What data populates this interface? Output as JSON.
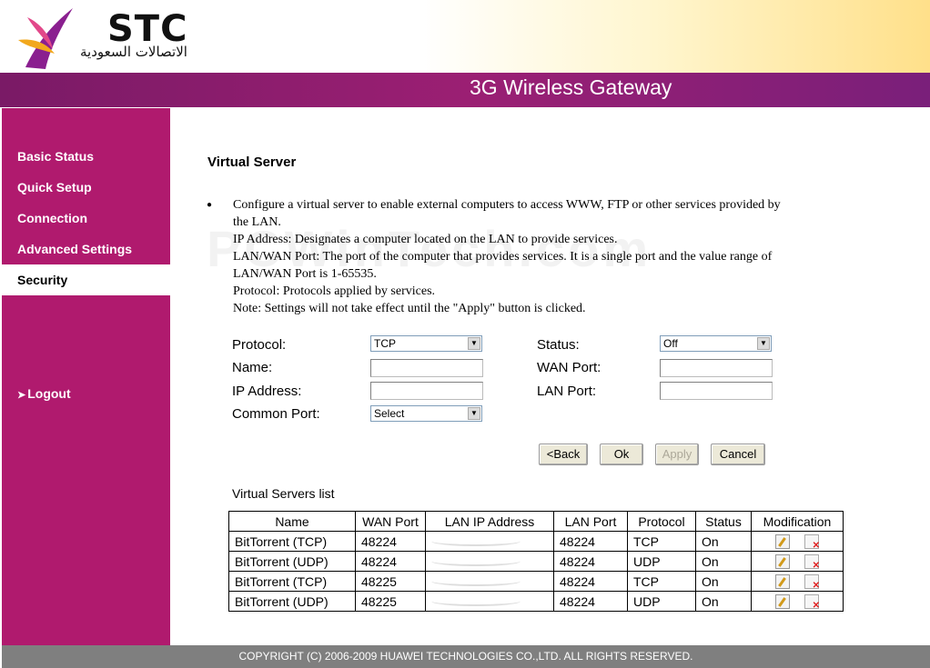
{
  "header": {
    "logo_text": "STC",
    "logo_arabic": "الاتصالات السعودية",
    "product_title": "3G Wireless Gateway"
  },
  "sidebar": {
    "items": [
      {
        "label": "Basic Status"
      },
      {
        "label": "Quick Setup"
      },
      {
        "label": "Connection"
      },
      {
        "label": "Advanced Settings"
      },
      {
        "label": "Security",
        "active": true
      }
    ],
    "logout_label": "Logout"
  },
  "main": {
    "title": "Virtual Server",
    "watermark": "PCWinTech.com",
    "description": [
      "Configure a virtual server to enable external computers to access WWW, FTP or other services provided by",
      "the LAN.",
      "IP Address: Designates a computer located on the LAN to provide services.",
      "LAN/WAN Port: The port of the computer that provides services. It is a single port and the value range of",
      "LAN/WAN Port is 1-65535.",
      "Protocol: Protocols applied by services.",
      "Note: Settings will not take effect until the \"Apply\" button is clicked."
    ],
    "form": {
      "protocol_label": "Protocol:",
      "protocol_value": "TCP",
      "name_label": "Name:",
      "name_value": "",
      "ip_label": "IP Address:",
      "ip_value": "",
      "common_port_label": "Common Port:",
      "common_port_value": "Select",
      "status_label": "Status:",
      "status_value": "Off",
      "wan_port_label": "WAN Port:",
      "wan_port_value": "",
      "lan_port_label": "LAN Port:",
      "lan_port_value": ""
    },
    "buttons": {
      "back": "<Back",
      "ok": "Ok",
      "apply": "Apply",
      "cancel": "Cancel"
    },
    "list_title": "Virtual Servers list",
    "table": {
      "headers": [
        "Name",
        "WAN Port",
        "LAN IP Address",
        "LAN Port",
        "Protocol",
        "Status",
        "Modification"
      ],
      "rows": [
        {
          "name": "BitTorrent (TCP)",
          "wan_port": "48224",
          "lan_port": "48224",
          "protocol": "TCP",
          "status": "On"
        },
        {
          "name": "BitTorrent (UDP)",
          "wan_port": "48224",
          "lan_port": "48224",
          "protocol": "UDP",
          "status": "On"
        },
        {
          "name": "BitTorrent (TCP)",
          "wan_port": "48225",
          "lan_port": "48224",
          "protocol": "TCP",
          "status": "On"
        },
        {
          "name": "BitTorrent (UDP)",
          "wan_port": "48225",
          "lan_port": "48224",
          "protocol": "UDP",
          "status": "On"
        }
      ]
    }
  },
  "footer": {
    "copyright": "COPYRIGHT (C) 2006-2009 HUAWEI TECHNOLOGIES CO.,LTD. ALL RIGHTS RESERVED."
  },
  "colors": {
    "sidebar": "#b01a6e",
    "title_bar": "#9b1f73",
    "footer": "#7f7f7f"
  }
}
